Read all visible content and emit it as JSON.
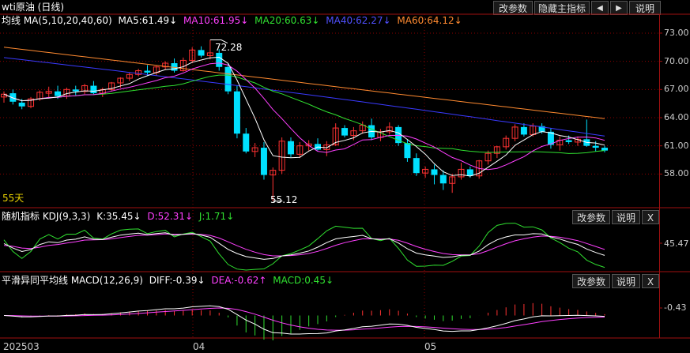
{
  "title": "wti原油 (日线)",
  "toolbar": {
    "modify_label": "改参数",
    "hide_label": "隐藏主指标",
    "left_arrow": "◀",
    "right_arrow": "▶",
    "help_label": "说明"
  },
  "main_legend": {
    "ma_label": "均线 MA(5,10,20,40,60)",
    "ma5": "MA5:61.49↓",
    "ma10": "MA10:61.95↓",
    "ma20": "MA20:60.63↓",
    "ma40": "MA40:62.27↓",
    "ma60": "MA60:64.12↓"
  },
  "high_marker": "72.28",
  "low_marker": "55.12",
  "days_label": "55天",
  "price_ticks": [
    "73.00",
    "70.00",
    "67.00",
    "64.00",
    "61.00",
    "58.00"
  ],
  "kdj_legend": {
    "name": "随机指标 KDJ(9,3,3)",
    "k": "K:35.45↓",
    "d": "D:52.31↓",
    "j": "J:1.71↓"
  },
  "kdj_tick": "45.47",
  "macd_legend": {
    "name": "平滑异同平均线 MACD(12,26,9)",
    "diff": "DIFF:-0.39↓",
    "dea": "DEA:-0.62↑",
    "macd": "MACD:0.45↓"
  },
  "macd_tick": "-0.43",
  "panel_buttons": {
    "modify": "改参数",
    "help": "说明",
    "close": "X"
  },
  "date_ticks": [
    "202503",
    "04",
    "05"
  ],
  "colors": {
    "up": "#ff3232",
    "down": "#00e0ff",
    "ma5": "#ffffff",
    "ma10": "#ff40ff",
    "ma20": "#30e030",
    "ma40": "#3a3aff",
    "ma60": "#ff8a30"
  },
  "chart_data": {
    "type": "candlestick",
    "ohlc": [
      [
        66.2,
        66.8,
        65.6,
        66.5
      ],
      [
        66.6,
        67.0,
        65.4,
        65.7
      ],
      [
        65.6,
        66.0,
        64.9,
        65.2
      ],
      [
        65.2,
        66.2,
        65.0,
        66.0
      ],
      [
        66.0,
        66.9,
        65.8,
        66.7
      ],
      [
        66.6,
        67.3,
        66.2,
        66.8
      ],
      [
        66.8,
        67.4,
        66.0,
        66.3
      ],
      [
        66.3,
        67.2,
        66.0,
        67.0
      ],
      [
        67.0,
        67.4,
        66.4,
        66.8
      ],
      [
        66.8,
        67.6,
        66.5,
        67.4
      ],
      [
        67.4,
        67.9,
        66.5,
        66.6
      ],
      [
        66.6,
        67.2,
        66.2,
        67.0
      ],
      [
        67.0,
        67.8,
        66.8,
        67.7
      ],
      [
        67.7,
        68.3,
        67.2,
        68.2
      ],
      [
        68.2,
        68.8,
        67.9,
        68.6
      ],
      [
        68.6,
        69.2,
        68.4,
        69.0
      ],
      [
        69.0,
        69.6,
        68.5,
        68.8
      ],
      [
        68.8,
        69.5,
        68.5,
        69.4
      ],
      [
        69.4,
        70.0,
        69.1,
        69.8
      ],
      [
        69.8,
        70.3,
        68.8,
        69.0
      ],
      [
        69.0,
        70.4,
        68.9,
        70.1
      ],
      [
        70.1,
        71.5,
        69.8,
        71.2
      ],
      [
        71.2,
        71.6,
        70.4,
        70.6
      ],
      [
        70.6,
        72.28,
        70.2,
        70.9
      ],
      [
        70.9,
        71.3,
        69.0,
        69.4
      ],
      [
        69.4,
        69.8,
        66.5,
        66.8
      ],
      [
        66.8,
        67.4,
        61.8,
        62.3
      ],
      [
        62.3,
        62.9,
        60.2,
        60.4
      ],
      [
        60.4,
        61.3,
        59.8,
        60.8
      ],
      [
        60.8,
        61.4,
        57.4,
        57.9
      ],
      [
        57.9,
        58.7,
        55.12,
        58.4
      ],
      [
        58.4,
        61.9,
        58.0,
        61.5
      ],
      [
        61.5,
        61.9,
        59.8,
        60.1
      ],
      [
        60.1,
        61.4,
        59.7,
        61.0
      ],
      [
        61.0,
        61.6,
        60.5,
        61.2
      ],
      [
        61.2,
        61.8,
        60.5,
        60.6
      ],
      [
        60.6,
        61.5,
        59.9,
        61.1
      ],
      [
        61.1,
        63.4,
        61.0,
        62.9
      ],
      [
        62.9,
        63.2,
        61.9,
        62.1
      ],
      [
        62.1,
        63.0,
        61.6,
        62.6
      ],
      [
        62.6,
        63.6,
        62.3,
        63.2
      ],
      [
        63.2,
        63.9,
        61.6,
        61.9
      ],
      [
        61.9,
        62.8,
        61.5,
        62.5
      ],
      [
        62.5,
        63.5,
        62.2,
        63.0
      ],
      [
        63.0,
        63.2,
        61.0,
        61.3
      ],
      [
        61.3,
        61.7,
        59.3,
        59.7
      ],
      [
        59.7,
        60.2,
        57.8,
        58.1
      ],
      [
        58.1,
        58.8,
        57.6,
        58.5
      ],
      [
        58.5,
        59.0,
        56.9,
        57.9
      ],
      [
        57.9,
        58.4,
        56.3,
        57.0
      ],
      [
        57.0,
        58.0,
        56.0,
        57.7
      ],
      [
        57.7,
        59.2,
        57.4,
        58.5
      ],
      [
        58.5,
        58.8,
        57.6,
        57.8
      ],
      [
        57.8,
        59.5,
        57.5,
        59.4
      ],
      [
        59.4,
        60.5,
        59.0,
        60.2
      ],
      [
        60.2,
        61.0,
        59.7,
        60.9
      ],
      [
        60.9,
        62.1,
        60.6,
        61.8
      ],
      [
        61.8,
        63.3,
        61.5,
        63.0
      ],
      [
        63.0,
        63.4,
        62.0,
        62.2
      ],
      [
        62.2,
        63.4,
        62.0,
        63.1
      ],
      [
        63.1,
        63.4,
        62.3,
        62.5
      ],
      [
        62.5,
        62.9,
        60.7,
        61.1
      ],
      [
        61.1,
        62.0,
        60.5,
        61.6
      ],
      [
        61.6,
        62.1,
        61.2,
        61.4
      ],
      [
        61.4,
        62.0,
        61.0,
        61.7
      ],
      [
        61.7,
        63.8,
        60.9,
        61.0
      ],
      [
        61.0,
        61.5,
        60.4,
        60.8
      ],
      [
        60.8,
        61.0,
        60.3,
        60.5
      ]
    ],
    "price_range": [
      54.5,
      73.5
    ],
    "x_ticks": [
      "202503",
      "04",
      "05"
    ]
  }
}
